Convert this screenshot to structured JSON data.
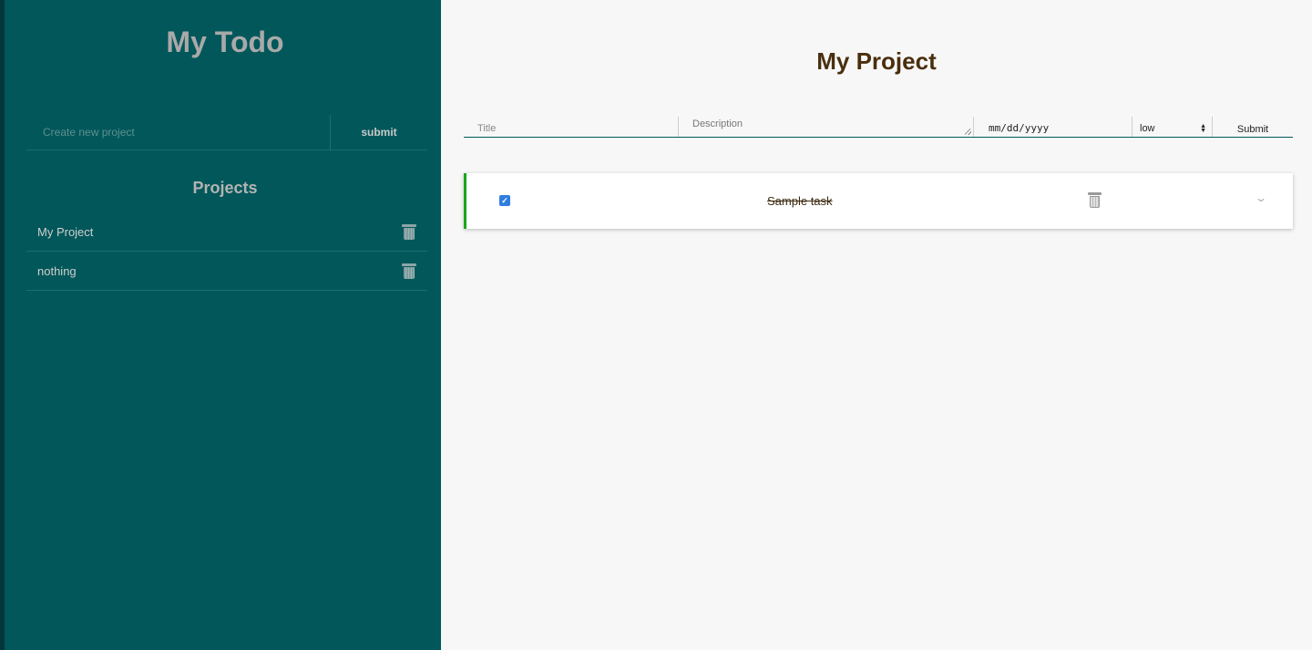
{
  "sidebar": {
    "app_title": "My Todo",
    "new_project": {
      "placeholder": "Create new project",
      "submit_label": "submit"
    },
    "projects_heading": "Projects",
    "projects": [
      {
        "name": "My Project"
      },
      {
        "name": "nothing"
      }
    ]
  },
  "main": {
    "title": "My Project",
    "form": {
      "title_placeholder": "Title",
      "description_placeholder": "Description",
      "date_placeholder": "mm/dd/yyyy",
      "priority_value": "low",
      "submit_label": "Submit"
    },
    "tasks": [
      {
        "name": "Sample task",
        "completed": true
      }
    ]
  },
  "colors": {
    "sidebar_bg": "#02575a",
    "title_brown": "#4a2f0e",
    "task_accent": "#19a61c",
    "checkbox": "#2f7de1"
  }
}
